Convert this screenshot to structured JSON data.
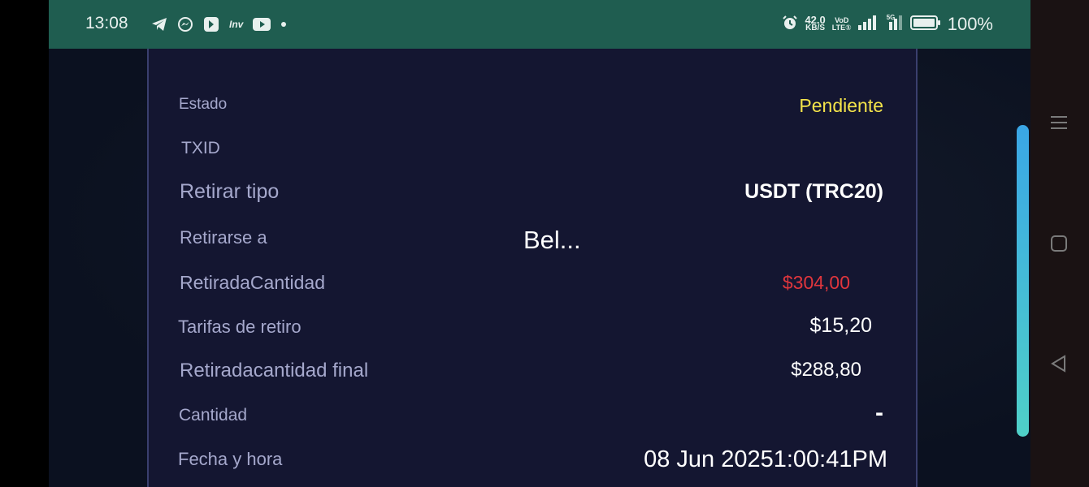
{
  "status_bar": {
    "time": "13:08",
    "net_speed_value": "42.0",
    "net_speed_unit": "KB/S",
    "volte_top": "VoD",
    "volte_bottom": "LTE①",
    "signal_label": "5G",
    "battery": "100%",
    "notification_icons": [
      "telegram-icon",
      "messenger-icon",
      "app-icon",
      "inv-icon",
      "youtube-icon",
      "dot-icon"
    ],
    "inv_label": "Inv"
  },
  "details": {
    "estado_label": "Estado",
    "estado_value": "Pendiente",
    "txid_label": "TXID",
    "tipo_label": "Retirar tipo",
    "tipo_value": "USDT (TRC20)",
    "retirarse_label": "Retirarse a",
    "retirarse_value": "Bel...",
    "cantidad_retirada_label": "RetiradaCantidad",
    "cantidad_retirada_value": "$304,00",
    "tarifas_label": "Tarifas de retiro",
    "tarifas_value": "$15,20",
    "final_label": "Retiradacantidad final",
    "final_value": "$288,80",
    "cantidad_label": "Cantidad",
    "cantidad_value": "-",
    "fecha_label": "Fecha y hora",
    "fecha_value": "08 Jun 20251:00:41PM"
  },
  "colors": {
    "status_bar_bg": "#1f5d50",
    "card_bg": "#141631",
    "label": "#a5a8cc",
    "pending": "#f3e34a",
    "amount_red": "#e0363d",
    "value_white": "#ffffff"
  },
  "nav_bar": {
    "icons": [
      "menu-icon",
      "home-icon",
      "back-icon"
    ]
  }
}
